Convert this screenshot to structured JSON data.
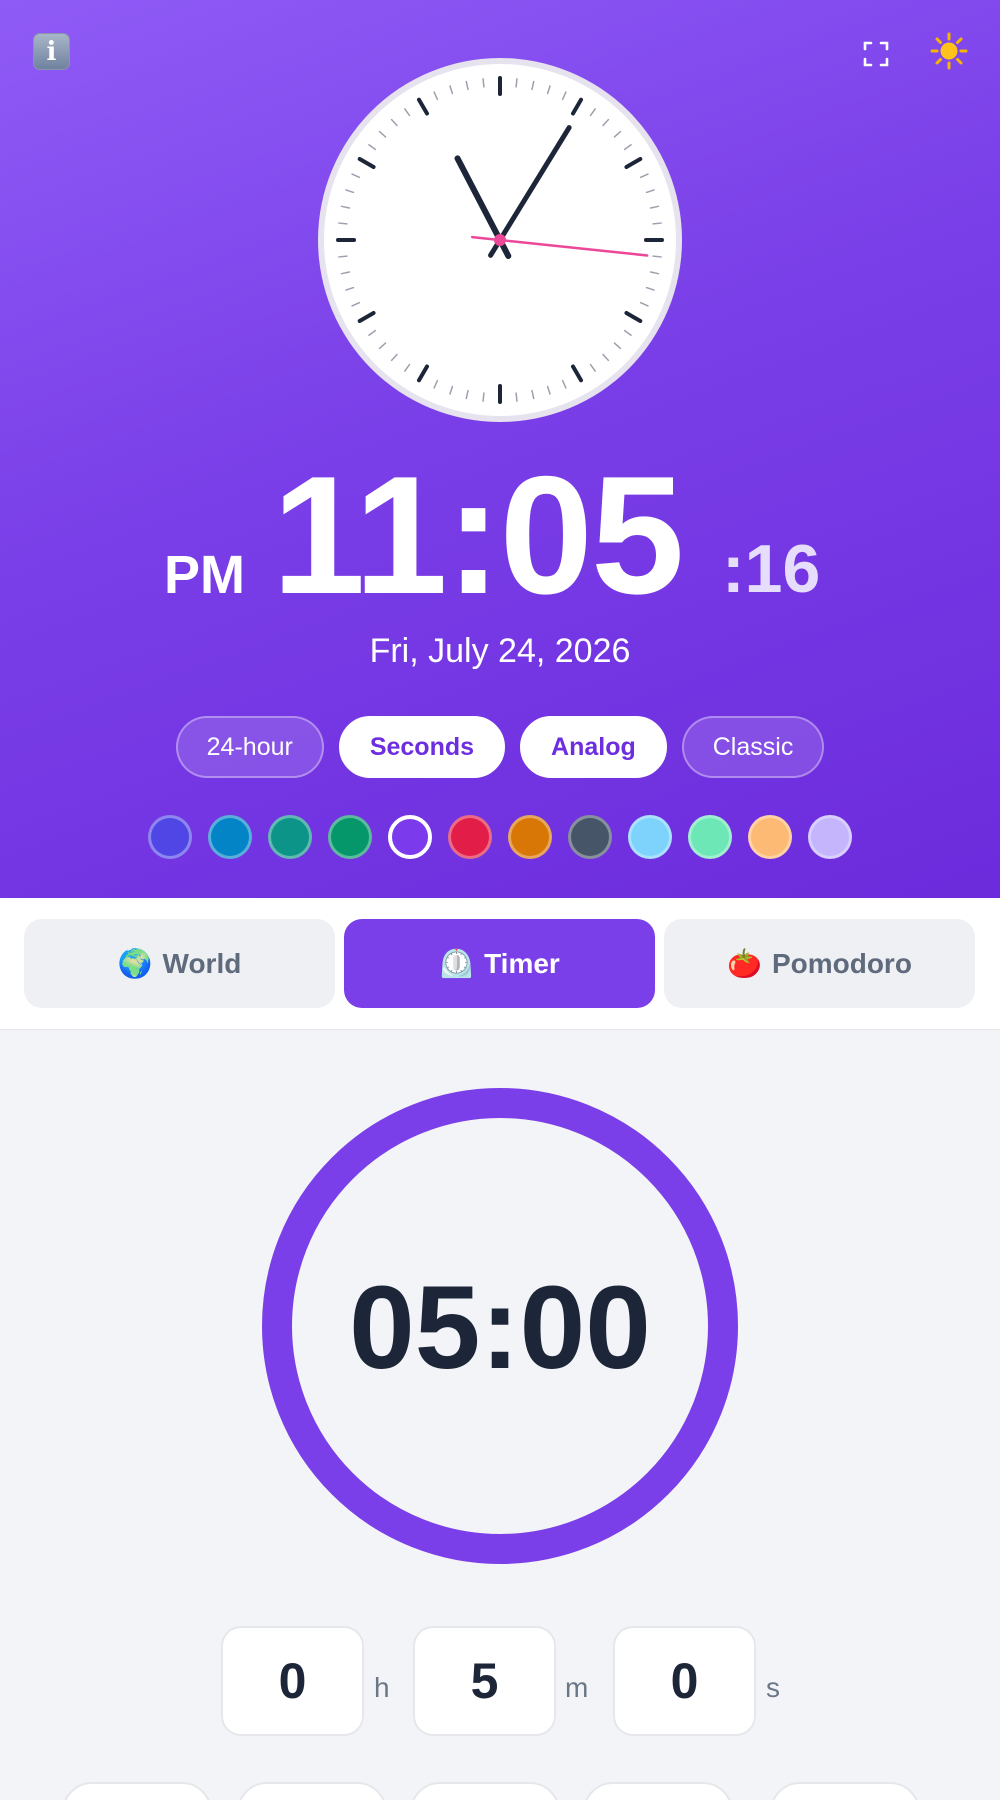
{
  "header": {
    "info_icon": "info-icon",
    "fullscreen_icon": "fullscreen-icon",
    "theme_icon": "sun-icon",
    "info_glyph": "i",
    "sun_glyph": "☀"
  },
  "clock": {
    "ampm": "PM",
    "hours_minutes": "11:05",
    "seconds": ":16",
    "date": "Fri, July 24, 2026",
    "analog": {
      "hour": 11,
      "minute": 5,
      "second": 16
    }
  },
  "toggles": [
    {
      "label": "24-hour",
      "active": false
    },
    {
      "label": "Seconds",
      "active": true
    },
    {
      "label": "Analog",
      "active": true
    },
    {
      "label": "Classic",
      "active": false
    }
  ],
  "theme_colors": {
    "selected_index": 4,
    "swatches": [
      "#4f46e5",
      "#0284c7",
      "#0d9488",
      "#059669",
      "#7c3aed",
      "#e11d48",
      "#d97706",
      "#475569",
      "#7dd3fc",
      "#6ee7b7",
      "#fdba74",
      "#c4b5fd"
    ]
  },
  "tabs": [
    {
      "emoji": "🌍",
      "label": "World",
      "active": false
    },
    {
      "emoji": "⏲️",
      "label": "Timer",
      "active": true
    },
    {
      "emoji": "🍅",
      "label": "Pomodoro",
      "active": false
    }
  ],
  "timer": {
    "display": "05:00",
    "progress": 1.0,
    "hours": "0",
    "minutes": "5",
    "seconds": "0",
    "unit_h": "h",
    "unit_m": "m",
    "unit_s": "s"
  },
  "colors": {
    "accent": "#7a3fe8",
    "second_hand": "#ec4899",
    "hands": "#1c2638"
  }
}
